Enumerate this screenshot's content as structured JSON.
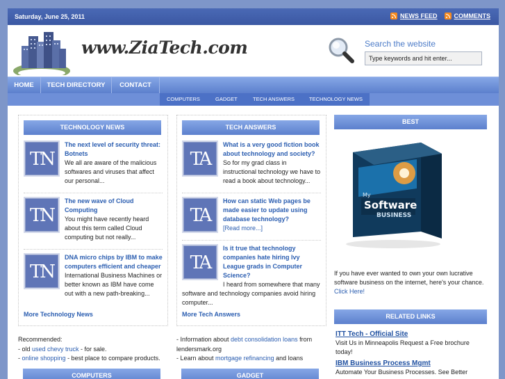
{
  "topbar": {
    "date": "Saturday, June 25, 2011",
    "news_feed": "NEWS FEED",
    "comments": "COMMENTS"
  },
  "header": {
    "logo_text": "www.ZiaTech.com",
    "search_title": "Search the website",
    "search_placeholder": "Type keywords and hit enter..."
  },
  "nav": [
    "HOME",
    "TECH DIRECTORY",
    "CONTACT"
  ],
  "subnav": [
    "COMPUTERS",
    "GADGET",
    "TECH ANSWERS",
    "TECHNOLOGY NEWS"
  ],
  "technology_news": {
    "heading": "TECHNOLOGY NEWS",
    "thumb": "TN",
    "posts": [
      {
        "title": "The next level of security threat: Botnets",
        "text": "We all are aware of the malicious softwares and viruses that affect our personal..."
      },
      {
        "title": "The new wave of Cloud Computing",
        "text": "You might have recently heard about this term called Cloud computing but not really..."
      },
      {
        "title": "DNA micro chips by IBM to make computers efficient and cheaper",
        "text": "International Business Machines or better known as IBM have come out with a new path-breaking..."
      }
    ],
    "more": "More Technology News"
  },
  "tech_answers": {
    "heading": "TECH ANSWERS",
    "thumb": "TA",
    "posts": [
      {
        "title": "What is a very good fiction book about technology and society?",
        "text": "So for my grad class in instructional technology we have to read a book about technology..."
      },
      {
        "title": "How can static Web pages be made easier to update using database technology?",
        "text": "[Read more...]"
      },
      {
        "title": "Is it true that technology companies hate hiring Ivy League grads in Computer Science?",
        "text": "I heard from somewhere that many software and technology companies avoid hiring computer..."
      }
    ],
    "more": "More Tech Answers"
  },
  "best": {
    "heading": "BEST",
    "box_line1": "My",
    "box_line2": "Software",
    "box_line3": "BUSINESS",
    "promo_text": "If you have ever wanted to own your own lucrative software business on the internet, here's your chance.",
    "promo_link": "Click Here!"
  },
  "related_links": {
    "heading": "RELATED LINKS",
    "items": [
      {
        "title": "ITT Tech - Official Site",
        "text": "Visit Us in Minneapolis Request a Free brochure today!"
      },
      {
        "title": "IBM Business Process Mgmt",
        "text": "Automate Your Business Processes. See Better"
      }
    ]
  },
  "recommended_left": {
    "label": "Recommended:",
    "line1_pre": "- old ",
    "line1_link": "used chevy truck",
    "line1_post": " - for sale.",
    "line2_pre": "- ",
    "line2_link": "online shopping",
    "line2_post": " - best place to compare products."
  },
  "recommended_mid": {
    "line1_pre": "- Information about ",
    "line1_link": "debt consolidation loans",
    "line1_post": " from lendersmark.org",
    "line2_pre": "- Learn about ",
    "line2_link": "mortgage refinancing",
    "line2_post": " and loans"
  },
  "bottom_heads": [
    "COMPUTERS",
    "GADGET"
  ],
  "colors": {
    "accent": "#5c80cd",
    "link": "#2a5db0",
    "background": "#7e96c9"
  }
}
